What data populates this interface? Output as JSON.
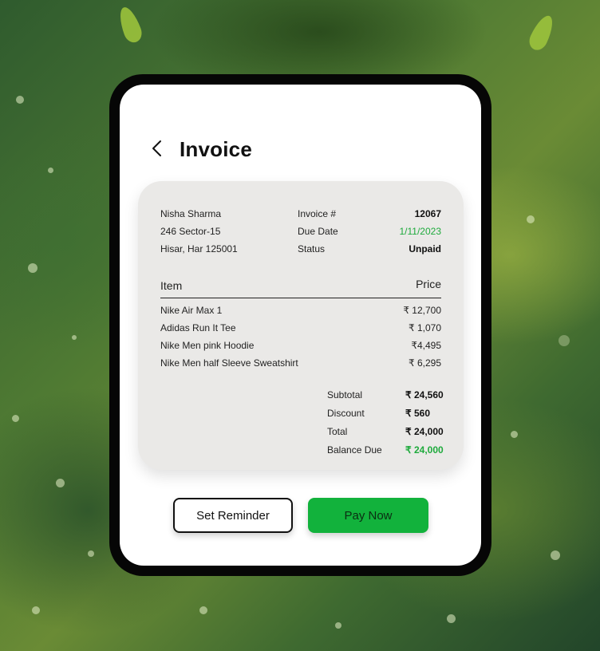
{
  "page": {
    "title": "Invoice",
    "back_icon": "chevron-left-icon"
  },
  "billing": {
    "name": "Nisha Sharma",
    "address_line1": "246 Sector-15",
    "address_line2": "Hisar, Har 125001"
  },
  "meta": {
    "invoice_label": "Invoice #",
    "invoice_value": "12067",
    "due_label": "Due Date",
    "due_value": "1/11/2023",
    "status_label": "Status",
    "status_value": "Unpaid"
  },
  "table": {
    "col_item": "Item",
    "col_price": "Price",
    "rows": [
      {
        "item": "Nike Air Max 1",
        "price": "₹ 12,700"
      },
      {
        "item": "Adidas Run It Tee",
        "price": "₹ 1,070"
      },
      {
        "item": "Nike Men pink Hoodie",
        "price": "₹4,495"
      },
      {
        "item": "Nike Men half Sleeve Sweatshirt",
        "price": "₹ 6,295"
      }
    ]
  },
  "totals": {
    "subtotal_label": "Subtotal",
    "subtotal_value": "₹ 24,560",
    "discount_label": "Discount",
    "discount_value": "₹ 560",
    "total_label": "Total",
    "total_value": "₹ 24,000",
    "balance_label": "Balance Due",
    "balance_value": "₹ 24,000"
  },
  "actions": {
    "reminder_label": "Set Reminder",
    "pay_label": "Pay Now"
  },
  "colors": {
    "accent_green": "#12b23c",
    "text_green": "#1eaa3c"
  }
}
